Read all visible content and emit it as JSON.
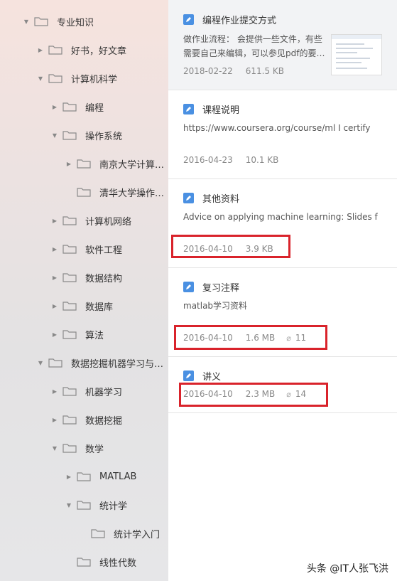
{
  "sidebar": {
    "items": [
      {
        "label": "专业知识",
        "expand": "down"
      },
      {
        "label": "好书，好文章",
        "expand": "right"
      },
      {
        "label": "计算机科学",
        "expand": "down"
      },
      {
        "label": "编程",
        "expand": "right"
      },
      {
        "label": "操作系统",
        "expand": "down"
      },
      {
        "label": "南京大学计算…",
        "expand": "right"
      },
      {
        "label": "清华大学操作…",
        "expand": "none"
      },
      {
        "label": "计算机网络",
        "expand": "right"
      },
      {
        "label": "软件工程",
        "expand": "right"
      },
      {
        "label": "数据结构",
        "expand": "right"
      },
      {
        "label": "数据库",
        "expand": "right"
      },
      {
        "label": "算法",
        "expand": "right"
      },
      {
        "label": "数据挖掘机器学习与…",
        "expand": "down"
      },
      {
        "label": "机器学习",
        "expand": "right"
      },
      {
        "label": "数据挖掘",
        "expand": "right"
      },
      {
        "label": "数学",
        "expand": "down"
      },
      {
        "label": "MATLAB",
        "expand": "right"
      },
      {
        "label": "统计学",
        "expand": "down"
      },
      {
        "label": "统计学入门",
        "expand": "none"
      },
      {
        "label": "线性代数",
        "expand": "none"
      }
    ]
  },
  "notes": [
    {
      "title": "编程作业提交方式",
      "snippet1": "做作业流程： 会提供一些文件，有些",
      "snippet2": "需要自己来编辑，可以参见pdf的要…",
      "date": "2018-02-22",
      "size": "611.5 KB"
    },
    {
      "title": "课程说明",
      "snippet1": "https://www.coursera.org/course/ml I certify",
      "date": "2016-04-23",
      "size": "10.1 KB"
    },
    {
      "title": "其他资料",
      "snippet1": "Advice on applying machine learning: Slides f",
      "date": "2016-04-10",
      "size": "3.9 KB"
    },
    {
      "title": "复习注释",
      "snippet1": "matlab学习资料",
      "date": "2016-04-10",
      "size": "1.6 MB",
      "attachments": "11"
    },
    {
      "title": "讲义",
      "date": "2016-04-10",
      "size": "2.3 MB",
      "attachments": "14"
    }
  ],
  "watermark": "头条 @IT人张飞洪",
  "colors": {
    "accent": "#4a90e2",
    "highlight": "#d9232b"
  }
}
